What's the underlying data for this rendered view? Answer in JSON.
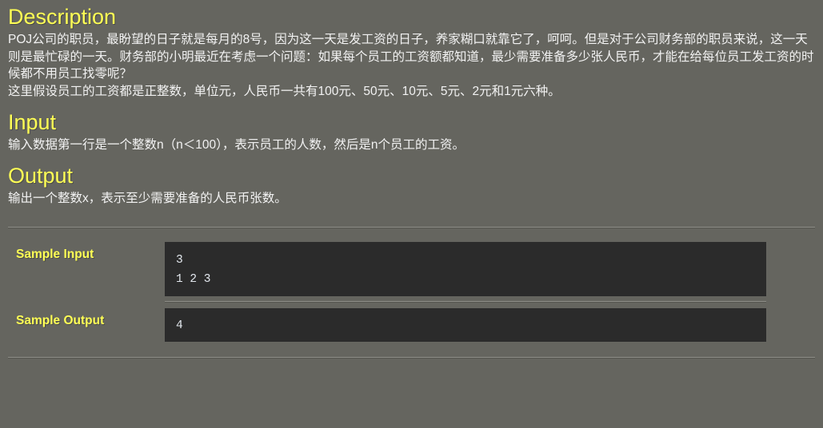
{
  "problem": {
    "description": {
      "heading": "Description",
      "paragraphs": [
        "POJ公司的职员，最盼望的日子就是每月的8号，因为这一天是发工资的日子，养家糊口就靠它了，呵呵。但是对于公司财务部的职员来说，这一天则是最忙碌的一天。财务部的小明最近在考虑一个问题：如果每个员工的工资额都知道，最少需要准备多少张人民币，才能在给每位员工发工资的时候都不用员工找零呢？",
        "这里假设员工的工资都是正整数，单位元，人民币一共有100元、50元、10元、5元、2元和1元六种。"
      ]
    },
    "input": {
      "heading": "Input",
      "paragraphs": [
        "输入数据第一行是一个整数n（n＜100），表示员工的人数，然后是n个员工的工资。"
      ]
    },
    "output": {
      "heading": "Output",
      "paragraphs": [
        "输出一个整数x，表示至少需要准备的人民币张数。"
      ]
    },
    "sample_input": {
      "label": "Sample Input",
      "code": "3\n1 2 3"
    },
    "sample_output": {
      "label": "Sample Output",
      "code": "4"
    }
  },
  "colors": {
    "background": "#65655f",
    "heading": "#ffff55",
    "body_text": "#f2f2f2",
    "code_background": "#2b2b2b",
    "code_text": "#e3e8ee",
    "divider_light": "#8e8e88",
    "divider_dark": "#55554f"
  }
}
